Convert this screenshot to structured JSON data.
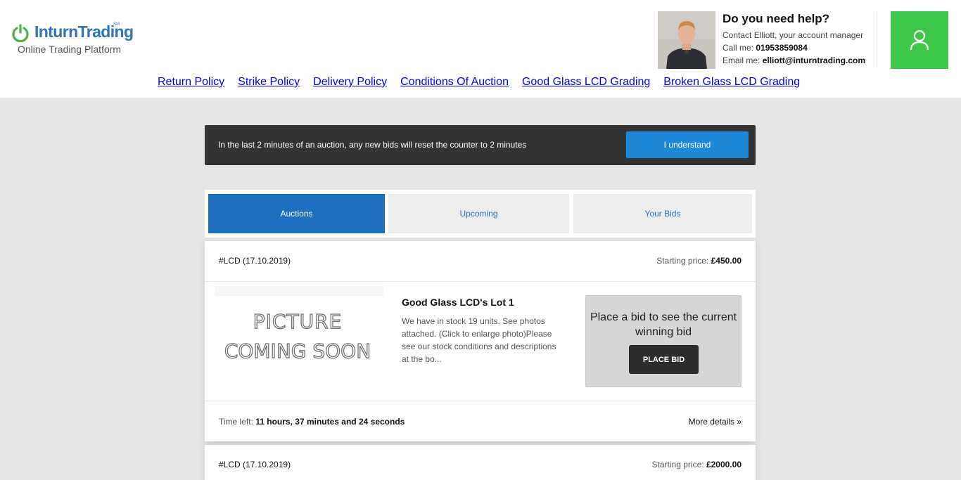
{
  "brand": {
    "name": "InturnTrading",
    "sm_mark": "SM",
    "tagline": "Online Trading Platform",
    "color": "#2f73b5",
    "accent": "#4cb04a"
  },
  "help": {
    "title": "Do you need help?",
    "contact": "Contact Elliott, your account manager",
    "call_label": "Call me:",
    "call_value": "01953859084",
    "email_label": "Email me:",
    "email_value": "elliott@inturntrading.com",
    "photo_icon": "account-manager-photo"
  },
  "account_button": {
    "icon": "user-icon",
    "color": "#3ec84a"
  },
  "nav": [
    {
      "label": "Return Policy"
    },
    {
      "label": "Strike Policy"
    },
    {
      "label": "Delivery Policy"
    },
    {
      "label": "Conditions Of Auction"
    },
    {
      "label": "Good Glass LCD Grading"
    },
    {
      "label": "Broken Glass LCD Grading"
    }
  ],
  "notice": {
    "text": "In the last 2 minutes of an auction, any new bids will reset the counter to 2 minutes",
    "button": "I understand"
  },
  "tabs": [
    {
      "label": "Auctions",
      "active": true
    },
    {
      "label": "Upcoming",
      "active": false
    },
    {
      "label": "Your Bids",
      "active": false
    }
  ],
  "lots": [
    {
      "id": "#LCD (17.10.2019)",
      "price_label": "Starting price:",
      "price": "£450.00",
      "image_line1": "PICTURE",
      "image_line2": "COMING SOON",
      "title": "Good Glass LCD's Lot 1",
      "description": "We have in stock 19 units. See photos attached. (Click to enlarge photo)Please see our stock conditions and descriptions at the bo...",
      "bid_prompt": "Place a bid to see the current winning bid",
      "bid_button": "PLACE BID",
      "time_label": "Time left:",
      "time_value": "11 hours, 37 minutes and 24 seconds",
      "more": "More details »"
    },
    {
      "id": "#LCD (17.10.2019)",
      "price_label": "Starting price:",
      "price": "£2000.00"
    }
  ]
}
